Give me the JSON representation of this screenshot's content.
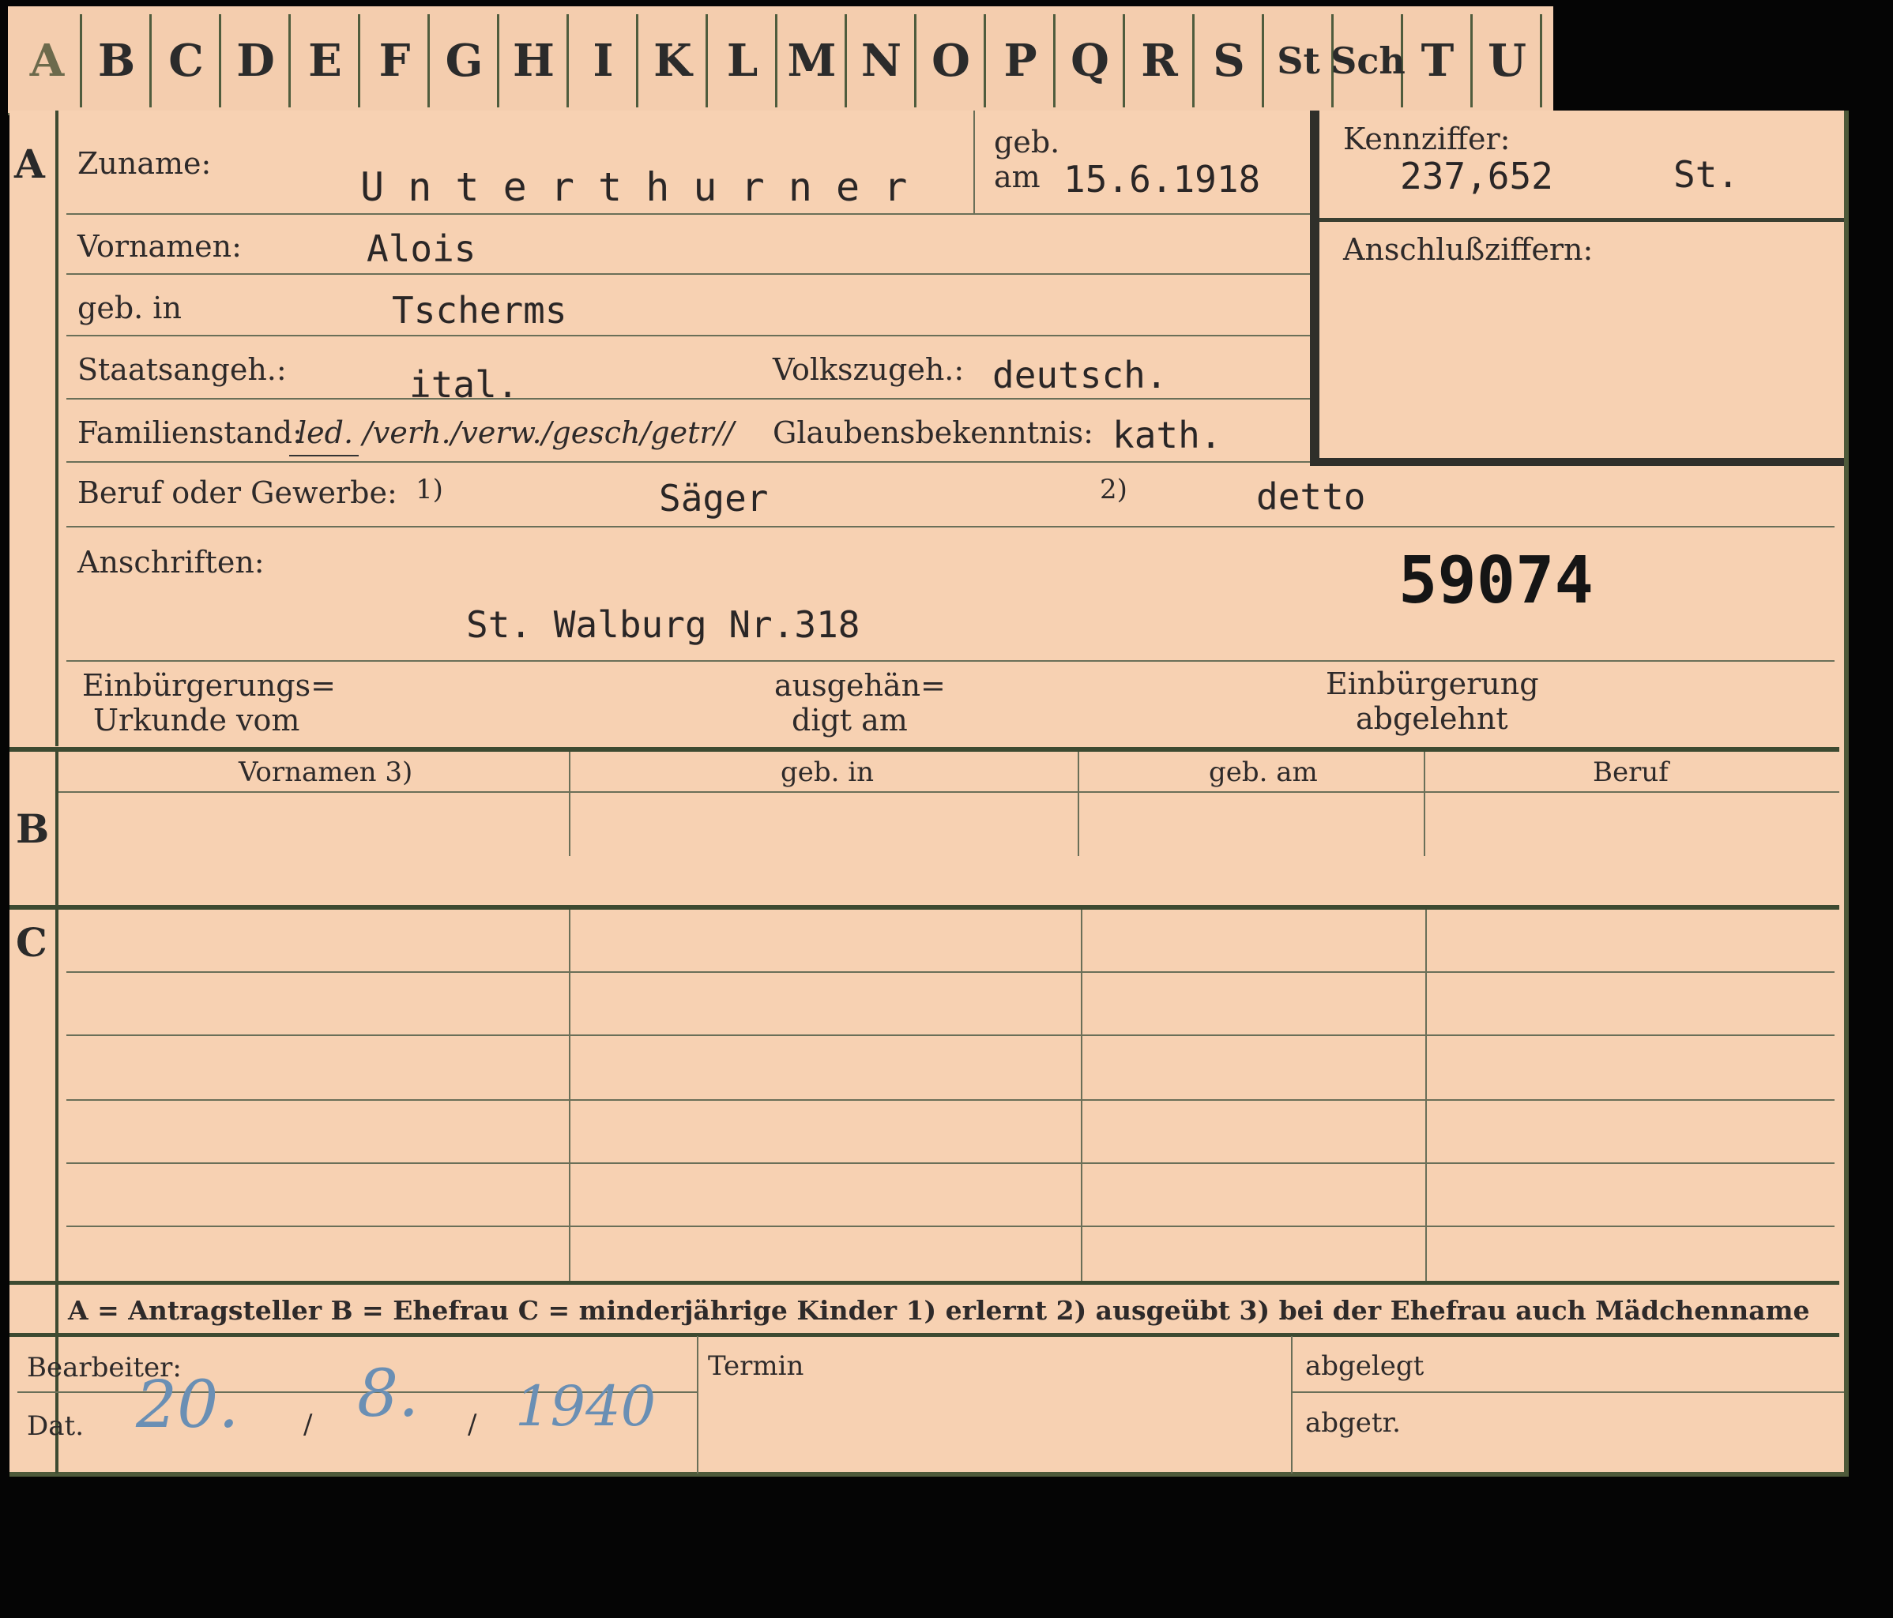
{
  "tabs": [
    "A",
    "B",
    "C",
    "D",
    "E",
    "F",
    "G",
    "H",
    "I",
    "K",
    "L",
    "M",
    "N",
    "O",
    "P",
    "Q",
    "R",
    "S",
    "St",
    "Sch",
    "T",
    "U"
  ],
  "section_a": {
    "mark": "A",
    "zuname_label": "Zuname:",
    "zuname_value": "U n t e r t h u r n e r",
    "geb_label_1": "geb.",
    "geb_label_2": "am",
    "geb_value": "15.6.1918",
    "vornamen_label": "Vornamen:",
    "vornamen_value": "Alois",
    "geb_in_label": "geb. in",
    "geb_in_value": "Tscherms",
    "staatsangeh_label": "Staatsangeh.:",
    "staatsangeh_value": "ital.",
    "volkszugeh_label": "Volkszugeh.:",
    "volkszugeh_value": "deutsch.",
    "familienstand_label": "Familienstand:",
    "familienstand_options": "led. /verh./verw./gesch/getr//",
    "glaubens_label": "Glaubensbekenntnis:",
    "glaubens_value": "kath.",
    "beruf_label": "Beruf oder Gewerbe:",
    "beruf_mark_1": "1)",
    "beruf_value_1": "Säger",
    "beruf_mark_2": "2)",
    "beruf_value_2": "detto",
    "anschriften_label": "Anschriften:",
    "anschriften_value": "St. Walburg Nr.318",
    "stamp_number": "59074",
    "einb_urkunde_1": "Einbürgerungs=",
    "einb_urkunde_2": "Urkunde vom",
    "ausgehaendigt_1": "ausgehän=",
    "ausgehaendigt_2": "digt am",
    "einb_abgelehnt_1": "Einbürgerung",
    "einb_abgelehnt_2": "abgelehnt"
  },
  "kennziffer": {
    "label": "Kennziffer:",
    "value": "237,652",
    "suffix": "St.",
    "anschluss_label": "Anschlußziffern:"
  },
  "section_b": {
    "mark": "B",
    "columns": [
      "Vornamen 3)",
      "geb. in",
      "geb. am",
      "Beruf"
    ]
  },
  "section_c": {
    "mark": "C"
  },
  "legend": "A = Antragsteller   B = Ehefrau   C = minderjährige Kinder   1) erlernt   2) ausgeübt   3) bei der Ehefrau auch Mädchenname",
  "footer": {
    "bearbeiter_label": "Bearbeiter:",
    "dat_label": "Dat.",
    "dat_day": "20.",
    "dat_month": "8.",
    "dat_year": "1940",
    "sep": "/",
    "termin_label": "Termin",
    "abgelegt_label": "abgelegt",
    "abgetr_label": "abgetr."
  }
}
